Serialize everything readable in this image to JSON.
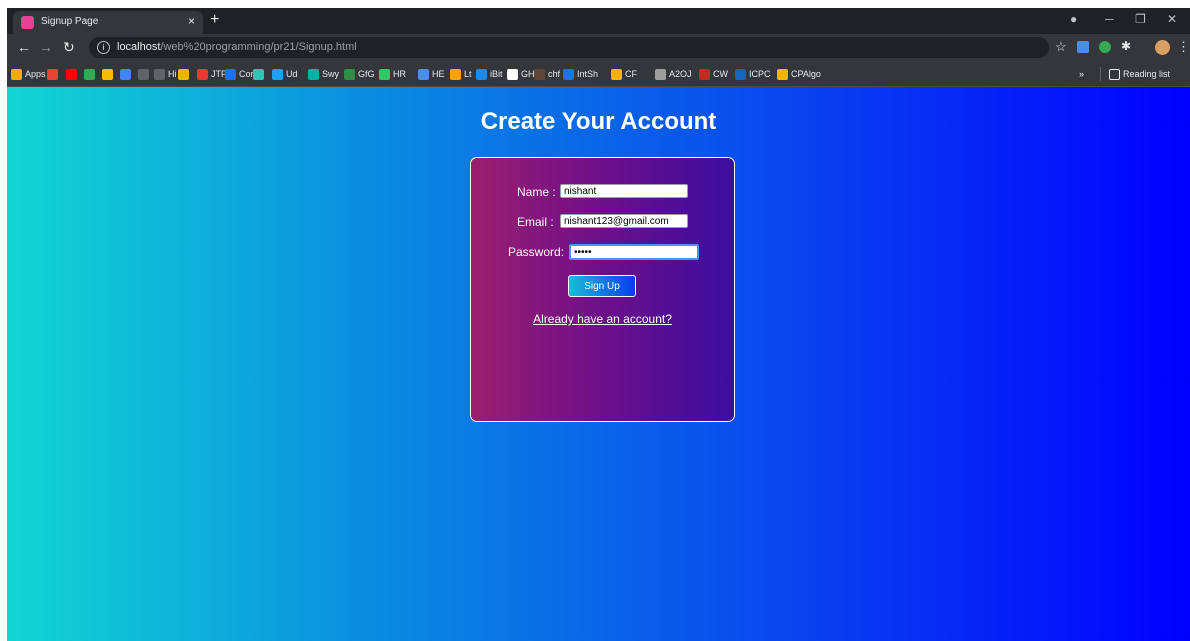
{
  "browser": {
    "tab_title": "Signup Page",
    "tab_close": "×",
    "new_tab": "+",
    "url_host": "localhost",
    "url_path": "/web%20programming/pr21/Signup.html",
    "bookmarks": [
      {
        "label": "Apps",
        "color": "#f9ab00"
      },
      {
        "label": "",
        "color": "#ea4335"
      },
      {
        "label": "",
        "color": "#ff0000"
      },
      {
        "label": "",
        "color": "#34a853"
      },
      {
        "label": "",
        "color": "#fbbc04"
      },
      {
        "label": "",
        "color": "#4285f4"
      },
      {
        "label": "",
        "color": "#5f6368"
      },
      {
        "label": "Hi",
        "color": "#5f6368"
      },
      {
        "label": "",
        "color": "#f0b400"
      },
      {
        "label": "JTP",
        "color": "#e53935"
      },
      {
        "label": "Cor",
        "color": "#1a73e8"
      },
      {
        "label": "",
        "color": "#2ec4b6"
      },
      {
        "label": "Ud",
        "color": "#1ea1f1"
      },
      {
        "label": "Swy",
        "color": "#00b3a4"
      },
      {
        "label": "GfG",
        "color": "#2f8d46"
      },
      {
        "label": "HR",
        "color": "#2ec866"
      },
      {
        "label": "HE",
        "color": "#4a90e2"
      },
      {
        "label": "Lt",
        "color": "#ffa116"
      },
      {
        "label": "iBit",
        "color": "#1e88e5"
      },
      {
        "label": "GH",
        "color": "#ffffff"
      },
      {
        "label": "chf",
        "color": "#5b4638"
      },
      {
        "label": "IntSh",
        "color": "#1a73e8"
      },
      {
        "label": "CF",
        "color": "#f4b400"
      },
      {
        "label": "A2OJ",
        "color": "#9e9e9e"
      },
      {
        "label": "CW",
        "color": "#c62828"
      },
      {
        "label": "ICPC",
        "color": "#1565c0"
      },
      {
        "label": "CPAlgo",
        "color": "#f4b400"
      }
    ],
    "more": "»",
    "reading_list": "Reading list"
  },
  "page": {
    "heading": "Create Your Account",
    "name_label": "Name :",
    "name_value": "nishant",
    "email_label": "Email :",
    "email_value": "nishant123@gmail.com",
    "password_label": "Password:",
    "password_value": "•••••",
    "signup_button": "Sign Up",
    "login_link": "Already have an account?"
  },
  "colors": {
    "gradient_start": "#12d6d2",
    "gradient_end": "#0000ff",
    "card_start": "#9a1f6e",
    "card_end": "#3a0e9e"
  }
}
